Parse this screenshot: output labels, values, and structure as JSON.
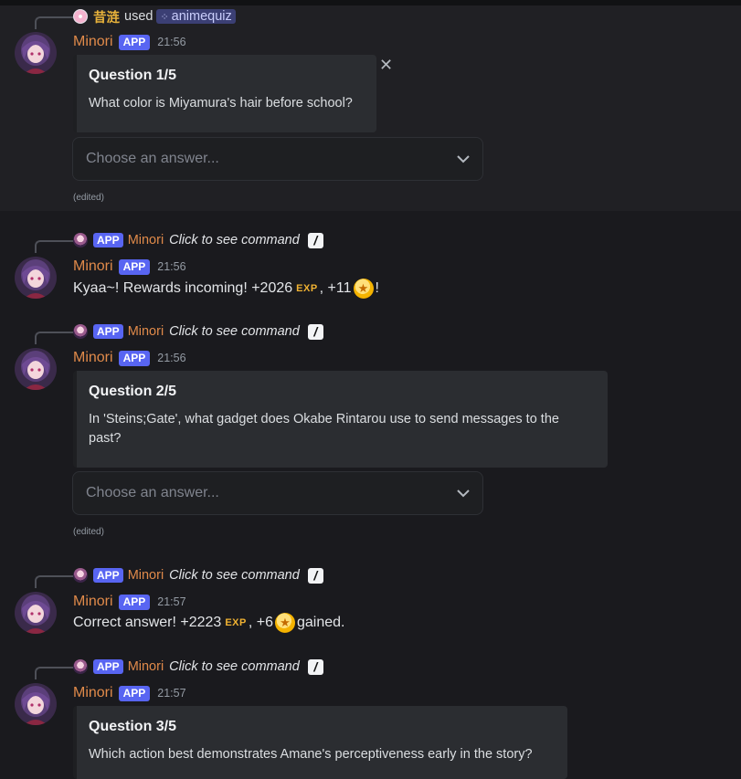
{
  "invoker": {
    "name": "昔涟",
    "used_label": "used",
    "command": "animequiz"
  },
  "bot": {
    "name": "Minori",
    "tag": "APP"
  },
  "reply": {
    "cmd_text": "Click to see command"
  },
  "messages": [
    {
      "time": "21:56",
      "embed_title": "Question 1/5",
      "embed_desc": "What color is Miyamura's hair before school?",
      "select_placeholder": "Choose an answer...",
      "edited": "(edited)"
    },
    {
      "time": "21:56",
      "content_pre": "Kyaa~! Rewards incoming! +2026",
      "exp_label": "EXP",
      "content_mid": ", +11",
      "content_post": "!"
    },
    {
      "time": "21:56",
      "embed_title": "Question 2/5",
      "embed_desc": "In 'Steins;Gate', what gadget does Okabe Rintarou use to send messages to the past?",
      "select_placeholder": "Choose an answer...",
      "edited": "(edited)"
    },
    {
      "time": "21:57",
      "content_pre": "Correct answer! +2223",
      "exp_label": "EXP",
      "content_mid": ", +6",
      "content_post": " gained."
    },
    {
      "time": "21:57",
      "embed_title": "Question 3/5",
      "embed_desc": "Which action best demonstrates Amane's perceptiveness early in the story?"
    }
  ],
  "icons": {
    "close": "close-icon",
    "chevron": "chevron-down-icon",
    "slash": "slash-command-icon",
    "coin": "coin-icon"
  },
  "colors": {
    "app_badge": "#5865f2",
    "bot_name": "#e08a4a",
    "user_name": "#e8b23b",
    "exp": "#f0b232"
  }
}
